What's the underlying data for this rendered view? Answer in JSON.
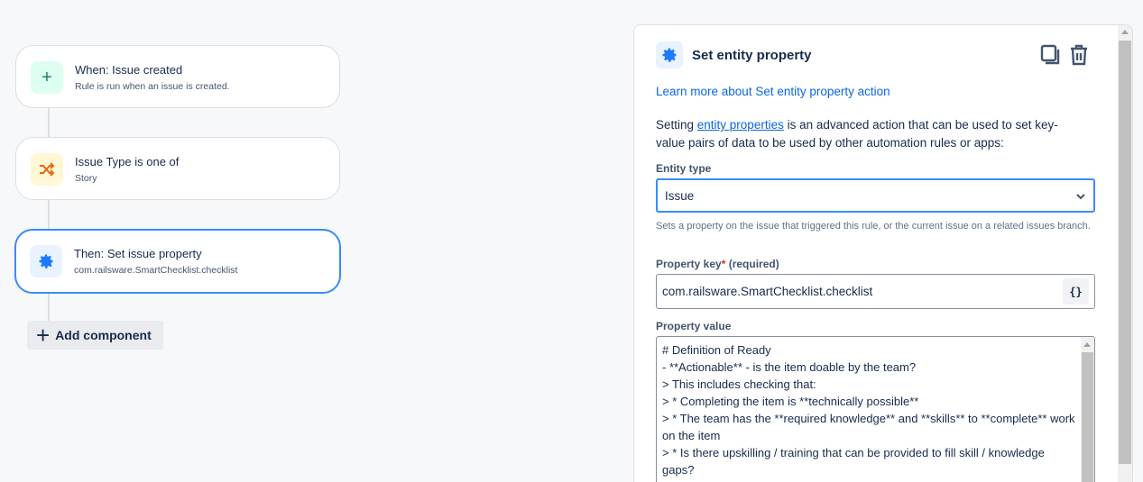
{
  "flow": {
    "trigger": {
      "title": "When: Issue created",
      "subtitle": "Rule is run when an issue is created.",
      "icon": "plus-icon"
    },
    "condition": {
      "title": "Issue Type is one of",
      "subtitle": "Story",
      "icon": "shuffle-icon"
    },
    "action": {
      "title": "Then: Set issue property",
      "subtitle": "com.railsware.SmartChecklist.checklist",
      "icon": "gear-icon"
    },
    "add_label": "Add component"
  },
  "panel": {
    "title": "Set entity property",
    "learn_more": "Learn more about Set entity property action",
    "desc_pre": "Setting ",
    "desc_link": "entity properties",
    "desc_post": " is an advanced action that can be used to set key-value pairs of data to be used by other automation rules or apps:",
    "entity_type_label": "Entity type",
    "entity_type_value": "Issue",
    "entity_type_help": "Sets a property on the issue that triggered this rule, or the current issue on a related issues branch.",
    "property_key_label": "Property key",
    "required_mark": "*",
    "required_text": "(required)",
    "property_key_value": "com.railsware.SmartChecklist.checklist",
    "smart_values_button": "{}",
    "property_value_label": "Property value",
    "property_value": "# Definition of Ready\n- **Actionable** - is the item doable by the team?\n> This includes checking that:\n> * Completing the item is **technically possible**\n> * The team has the **required knowledge** and **skills** to **complete** work on the item\n> * Is there upskilling / training that can be provided to fill skill / knowledge gaps?"
  },
  "colors": {
    "accent": "#388bff",
    "link": "#0c66e4"
  }
}
